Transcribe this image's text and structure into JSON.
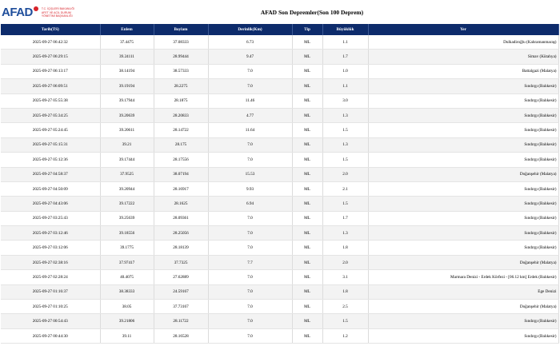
{
  "header": {
    "logo_text": "AFAD",
    "logo_sub": [
      "T.C. İÇİŞLERİ BAKANLIĞI",
      "AFET VE ACİL DURUM",
      "YÖNETİMİ BAŞKANLIĞI"
    ],
    "title": "AFAD Son Depremler(Son 100 Deprem)"
  },
  "colors": {
    "header_bg": "#0d2b6b",
    "logo_blue": "#1f4e9b",
    "logo_red": "#d8232a"
  },
  "table": {
    "columns": [
      "Tarih(TS)",
      "Enlem",
      "Boylam",
      "Derinlik(Km)",
      "Tip",
      "Büyüklük",
      "Yer"
    ],
    "rows": [
      [
        "2025-09-27 06:42:32",
        "37.4475",
        "37.08333",
        "6.73",
        "ML",
        "1.1",
        "Dulkadiroğlu (Kahramanmaraş)"
      ],
      [
        "2025-09-27 06:29:15",
        "39.24111",
        "28.99444",
        "9.47",
        "ML",
        "1.7",
        "Simav (Kütahya)"
      ],
      [
        "2025-09-27 06:13:17",
        "38.14194",
        "38.57333",
        "7.0",
        "ML",
        "1.0",
        "Battalgazi (Malatya)"
      ],
      [
        "2025-09-27 06:09:51",
        "39.19194",
        "28.2275",
        "7.0",
        "ML",
        "1.1",
        "Sındırgı (Balıkesir)"
      ],
      [
        "2025-09-27 05:55:38",
        "39.17944",
        "28.1875",
        "11.46",
        "ML",
        "3.0",
        "Sındırgı (Balıkesir)"
      ],
      [
        "2025-09-27 05:34:25",
        "39.20639",
        "28.20833",
        "4.77",
        "ML",
        "1.3",
        "Sındırgı (Balıkesir)"
      ],
      [
        "2025-09-27 05:24:45",
        "39.20611",
        "28.14722",
        "11.64",
        "ML",
        "1.5",
        "Sındırgı (Balıkesir)"
      ],
      [
        "2025-09-27 05:15:31",
        "39.21",
        "28.175",
        "7.0",
        "ML",
        "1.3",
        "Sındırgı (Balıkesir)"
      ],
      [
        "2025-09-27 05:12:36",
        "39.17444",
        "28.17556",
        "7.0",
        "ML",
        "1.5",
        "Sındırgı (Balıkesir)"
      ],
      [
        "2025-09-27 04:58:37",
        "37.9525",
        "38.07194",
        "15.53",
        "ML",
        "2.0",
        "Doğanşehir (Malatya)"
      ],
      [
        "2025-09-27 04:50:09",
        "39.20944",
        "28.16917",
        "9.93",
        "ML",
        "2.1",
        "Sındırgı (Balıkesir)"
      ],
      [
        "2025-09-27 04:43:06",
        "39.17222",
        "28.1625",
        "6.94",
        "ML",
        "1.5",
        "Sındırgı (Balıkesir)"
      ],
      [
        "2025-09-27 03:25:43",
        "39.25639",
        "28.09361",
        "7.0",
        "ML",
        "1.7",
        "Sındırgı (Balıkesir)"
      ],
      [
        "2025-09-27 03:12:46",
        "39.18556",
        "28.25056",
        "7.0",
        "ML",
        "1.3",
        "Sındırgı (Balıkesir)"
      ],
      [
        "2025-09-27 03:12:06",
        "39.1775",
        "28.18139",
        "7.0",
        "ML",
        "1.8",
        "Sındırgı (Balıkesir)"
      ],
      [
        "2025-09-27 02:38:16",
        "37.97417",
        "37.7325",
        "7.7",
        "ML",
        "2.0",
        "Doğanşehir (Malatya)"
      ],
      [
        "2025-09-27 02:28:24",
        "40.4075",
        "27.62889",
        "7.0",
        "ML",
        "3.1",
        "Marmara Denizi - Erdek Körfezi - [06.12 km] Erdek (Balıkesir)"
      ],
      [
        "2025-09-27 01:16:37",
        "38.38333",
        "24.59167",
        "7.0",
        "ML",
        "1.8",
        "Ege Denizi"
      ],
      [
        "2025-09-27 01:10:25",
        "38.05",
        "37.73167",
        "7.0",
        "ML",
        "2.5",
        "Doğanşehir (Malatya)"
      ],
      [
        "2025-09-27 00:54:43",
        "39.21806",
        "28.11722",
        "7.0",
        "ML",
        "1.5",
        "Sındırgı (Balıkesir)"
      ],
      [
        "2025-09-27 00:44:30",
        "39.11",
        "28.16528",
        "7.0",
        "ML",
        "1.2",
        "Sındırgı (Balıkesir)"
      ]
    ]
  }
}
